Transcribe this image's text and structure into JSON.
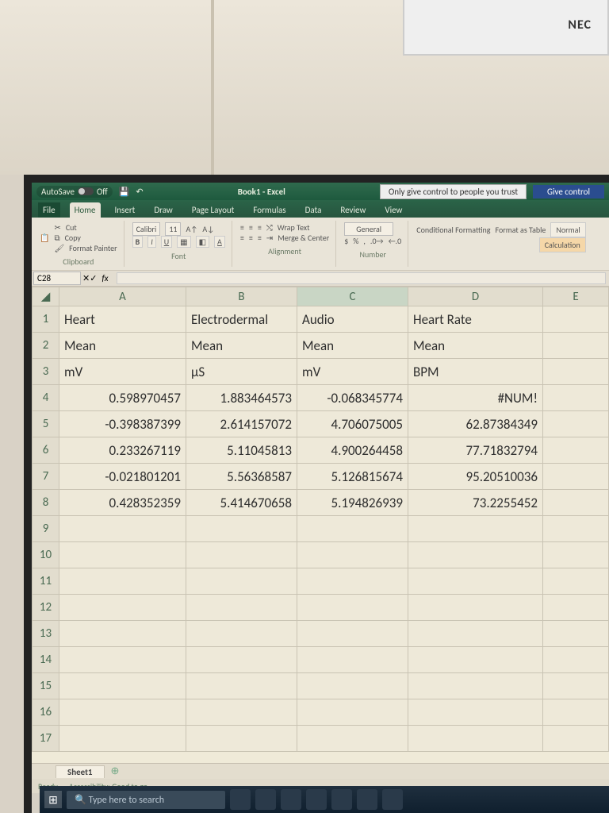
{
  "projector_brand": "NEC",
  "titlebar": {
    "autosave_label": "AutoSave",
    "autosave_state": "Off",
    "doc_title": "Book1 - Excel",
    "trust_msg": "Only give control to people you trust",
    "give_control": "Give control"
  },
  "tabs": {
    "file": "File",
    "home": "Home",
    "insert": "Insert",
    "draw": "Draw",
    "page_layout": "Page Layout",
    "formulas": "Formulas",
    "data": "Data",
    "review": "Review",
    "view": "View"
  },
  "ribbon": {
    "clipboard": {
      "cut": "Cut",
      "copy": "Copy",
      "fp": "Format Painter",
      "paste": "Paste",
      "label": "Clipboard"
    },
    "font": {
      "name": "Calibri",
      "size": "11",
      "label": "Font"
    },
    "alignment": {
      "wrap": "Wrap Text",
      "merge": "Merge & Center",
      "label": "Alignment"
    },
    "number": {
      "format": "General",
      "label": "Number"
    },
    "styles": {
      "cond": "Conditional Formatting",
      "fmt": "Format as Table",
      "normal": "Normal",
      "calc": "Calculation"
    }
  },
  "namebox": "C28",
  "columns": [
    "A",
    "B",
    "C",
    "D",
    "E"
  ],
  "rows": [
    {
      "r": "1",
      "cells": [
        {
          "v": "Heart",
          "a": "txt"
        },
        {
          "v": "Electrodermal",
          "a": "txt"
        },
        {
          "v": "Audio",
          "a": "txt"
        },
        {
          "v": "Heart Rate",
          "a": "txt"
        },
        {
          "v": "",
          "a": "txt"
        }
      ]
    },
    {
      "r": "2",
      "cells": [
        {
          "v": "Mean",
          "a": "txt"
        },
        {
          "v": "Mean",
          "a": "txt"
        },
        {
          "v": "Mean",
          "a": "txt"
        },
        {
          "v": "Mean",
          "a": "txt"
        },
        {
          "v": "",
          "a": "txt"
        }
      ]
    },
    {
      "r": "3",
      "cells": [
        {
          "v": "mV",
          "a": "txt"
        },
        {
          "v": "µS",
          "a": "txt"
        },
        {
          "v": "mV",
          "a": "txt"
        },
        {
          "v": "BPM",
          "a": "txt"
        },
        {
          "v": "",
          "a": "txt"
        }
      ]
    },
    {
      "r": "4",
      "cells": [
        {
          "v": "0.598970457",
          "a": "num"
        },
        {
          "v": "1.883464573",
          "a": "num"
        },
        {
          "v": "-0.068345774",
          "a": "num"
        },
        {
          "v": "#NUM!",
          "a": "num"
        },
        {
          "v": "",
          "a": "txt"
        }
      ]
    },
    {
      "r": "5",
      "cells": [
        {
          "v": "-0.398387399",
          "a": "num"
        },
        {
          "v": "2.614157072",
          "a": "num"
        },
        {
          "v": "4.706075005",
          "a": "num"
        },
        {
          "v": "62.87384349",
          "a": "num"
        },
        {
          "v": "",
          "a": "txt"
        }
      ]
    },
    {
      "r": "6",
      "cells": [
        {
          "v": "0.233267119",
          "a": "num"
        },
        {
          "v": "5.11045813",
          "a": "num"
        },
        {
          "v": "4.900264458",
          "a": "num"
        },
        {
          "v": "77.71832794",
          "a": "num"
        },
        {
          "v": "",
          "a": "txt"
        }
      ]
    },
    {
      "r": "7",
      "cells": [
        {
          "v": "-0.021801201",
          "a": "num"
        },
        {
          "v": "5.56368587",
          "a": "num"
        },
        {
          "v": "5.126815674",
          "a": "num"
        },
        {
          "v": "95.20510036",
          "a": "num"
        },
        {
          "v": "",
          "a": "txt"
        }
      ]
    },
    {
      "r": "8",
      "cells": [
        {
          "v": "0.428352359",
          "a": "num"
        },
        {
          "v": "5.414670658",
          "a": "num"
        },
        {
          "v": "5.194826939",
          "a": "num"
        },
        {
          "v": "73.2255452",
          "a": "num"
        },
        {
          "v": "",
          "a": "txt"
        }
      ]
    },
    {
      "r": "9",
      "cells": [
        {
          "v": "",
          "a": "txt"
        },
        {
          "v": "",
          "a": "txt"
        },
        {
          "v": "",
          "a": "txt"
        },
        {
          "v": "",
          "a": "txt"
        },
        {
          "v": "",
          "a": "txt"
        }
      ]
    },
    {
      "r": "10",
      "cells": [
        {
          "v": "",
          "a": "txt"
        },
        {
          "v": "",
          "a": "txt"
        },
        {
          "v": "",
          "a": "txt"
        },
        {
          "v": "",
          "a": "txt"
        },
        {
          "v": "",
          "a": "txt"
        }
      ]
    },
    {
      "r": "11",
      "cells": [
        {
          "v": "",
          "a": "txt"
        },
        {
          "v": "",
          "a": "txt"
        },
        {
          "v": "",
          "a": "txt"
        },
        {
          "v": "",
          "a": "txt"
        },
        {
          "v": "",
          "a": "txt"
        }
      ]
    },
    {
      "r": "12",
      "cells": [
        {
          "v": "",
          "a": "txt"
        },
        {
          "v": "",
          "a": "txt"
        },
        {
          "v": "",
          "a": "txt"
        },
        {
          "v": "",
          "a": "txt"
        },
        {
          "v": "",
          "a": "txt"
        }
      ]
    },
    {
      "r": "13",
      "cells": [
        {
          "v": "",
          "a": "txt"
        },
        {
          "v": "",
          "a": "txt"
        },
        {
          "v": "",
          "a": "txt"
        },
        {
          "v": "",
          "a": "txt"
        },
        {
          "v": "",
          "a": "txt"
        }
      ]
    },
    {
      "r": "14",
      "cells": [
        {
          "v": "",
          "a": "txt"
        },
        {
          "v": "",
          "a": "txt"
        },
        {
          "v": "",
          "a": "txt"
        },
        {
          "v": "",
          "a": "txt"
        },
        {
          "v": "",
          "a": "txt"
        }
      ]
    },
    {
      "r": "15",
      "cells": [
        {
          "v": "",
          "a": "txt"
        },
        {
          "v": "",
          "a": "txt"
        },
        {
          "v": "",
          "a": "txt"
        },
        {
          "v": "",
          "a": "txt"
        },
        {
          "v": "",
          "a": "txt"
        }
      ]
    },
    {
      "r": "16",
      "cells": [
        {
          "v": "",
          "a": "txt"
        },
        {
          "v": "",
          "a": "txt"
        },
        {
          "v": "",
          "a": "txt"
        },
        {
          "v": "",
          "a": "txt"
        },
        {
          "v": "",
          "a": "txt"
        }
      ]
    },
    {
      "r": "17",
      "cells": [
        {
          "v": "",
          "a": "txt"
        },
        {
          "v": "",
          "a": "txt"
        },
        {
          "v": "",
          "a": "txt"
        },
        {
          "v": "",
          "a": "txt"
        },
        {
          "v": "",
          "a": "txt"
        }
      ]
    }
  ],
  "sheet_tab": "Sheet1",
  "status": {
    "ready": "Ready",
    "acc": "Accessibility: Good to go"
  },
  "taskbar": {
    "search": "Type here to search"
  }
}
